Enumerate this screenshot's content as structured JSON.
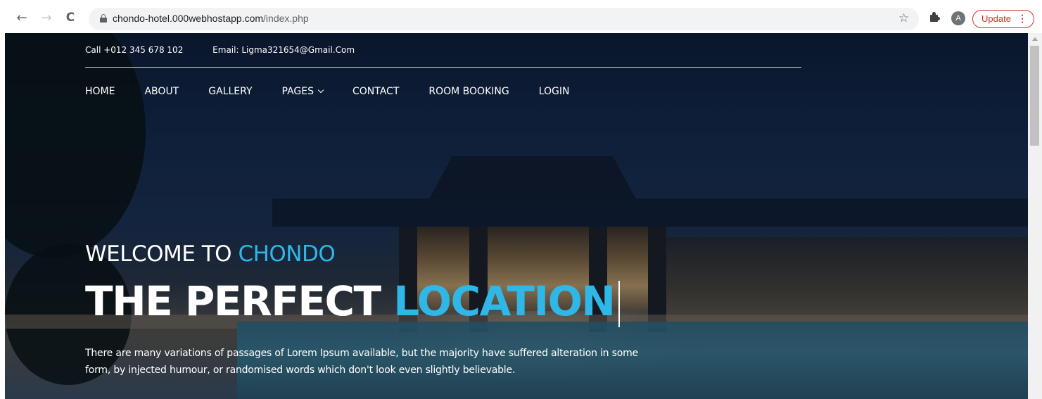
{
  "browser": {
    "url_host": "chondo-hotel.000webhostapp.com",
    "url_path": "/index.php",
    "profile_initial": "A",
    "update_label": "Update",
    "update_menu": "⋮",
    "icons": {
      "back": "←",
      "forward": "→",
      "reload": "C",
      "bookmark": "☆"
    }
  },
  "topbar": {
    "phone": "Call +012 345 678 102",
    "email": "Email: Ligma321654@Gmail.Com"
  },
  "nav": {
    "home": "HOME",
    "about": "ABOUT",
    "gallery": "GALLERY",
    "pages": "PAGES",
    "contact": "CONTACT",
    "room_booking": "ROOM BOOKING",
    "login": "LOGIN"
  },
  "hero": {
    "welcome_prefix": "WELCOME TO ",
    "welcome_brand": "CHONDO",
    "headline_white": "THE PERFECT ",
    "headline_accent": "LOCATION",
    "description": "There are many variations of passages of Lorem Ipsum available, but the majority have suffered alteration in some form, by injected humour, or randomised words which don't look even slightly believable."
  },
  "colors": {
    "accent": "#2fb7e8",
    "update": "#d93025"
  }
}
